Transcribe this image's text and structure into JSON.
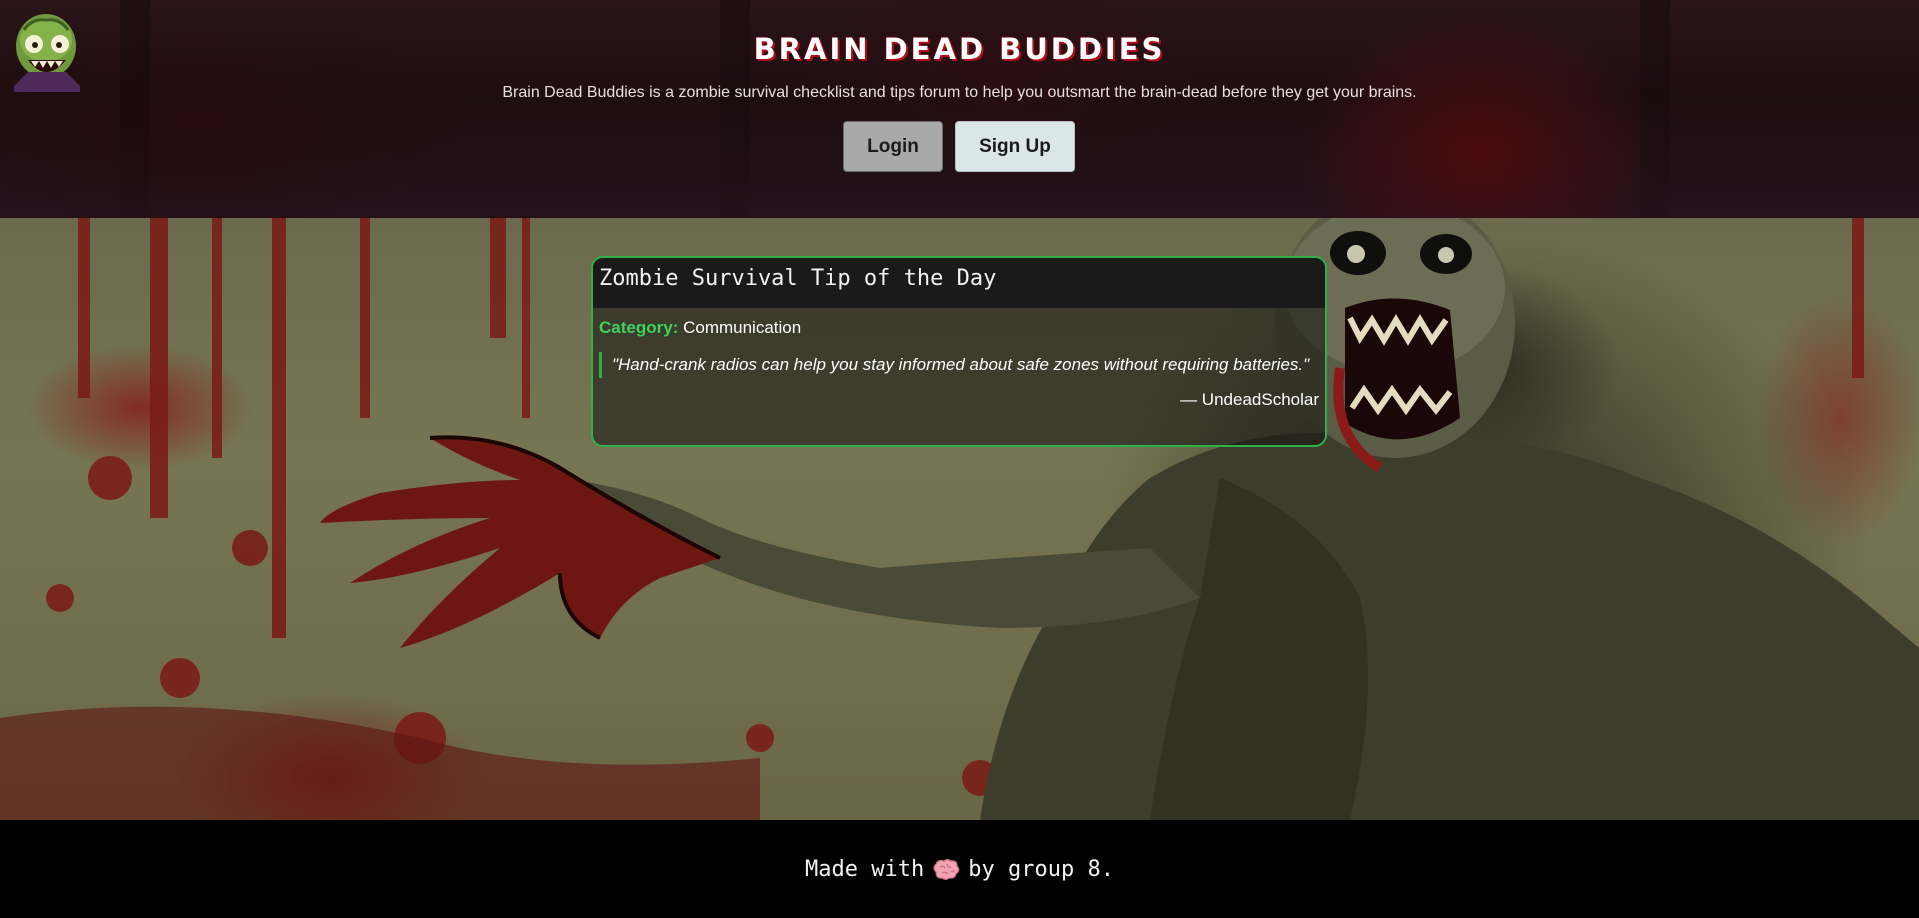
{
  "header": {
    "logo_name": "zombie-head-logo",
    "title": "BRAIN DEAD BUDDIES",
    "tagline": "Brain Dead Buddies is a zombie survival checklist and tips forum to help you outsmart the brain-dead before they get your brains.",
    "login_label": "Login",
    "signup_label": "Sign Up"
  },
  "tip": {
    "title": "Zombie Survival Tip of the Day",
    "category_label": "Category:",
    "category": "Communication",
    "quote": "\"Hand-crank radios can help you stay informed about safe zones without requiring batteries.\"",
    "author": "— UndeadScholar"
  },
  "footer": {
    "prefix": "Made with",
    "icon": "brain-icon",
    "suffix": "by group 8."
  },
  "colors": {
    "accent_green": "#31b04a",
    "title_shadow_red": "#b10d1a",
    "footer_bg": "#000000"
  }
}
